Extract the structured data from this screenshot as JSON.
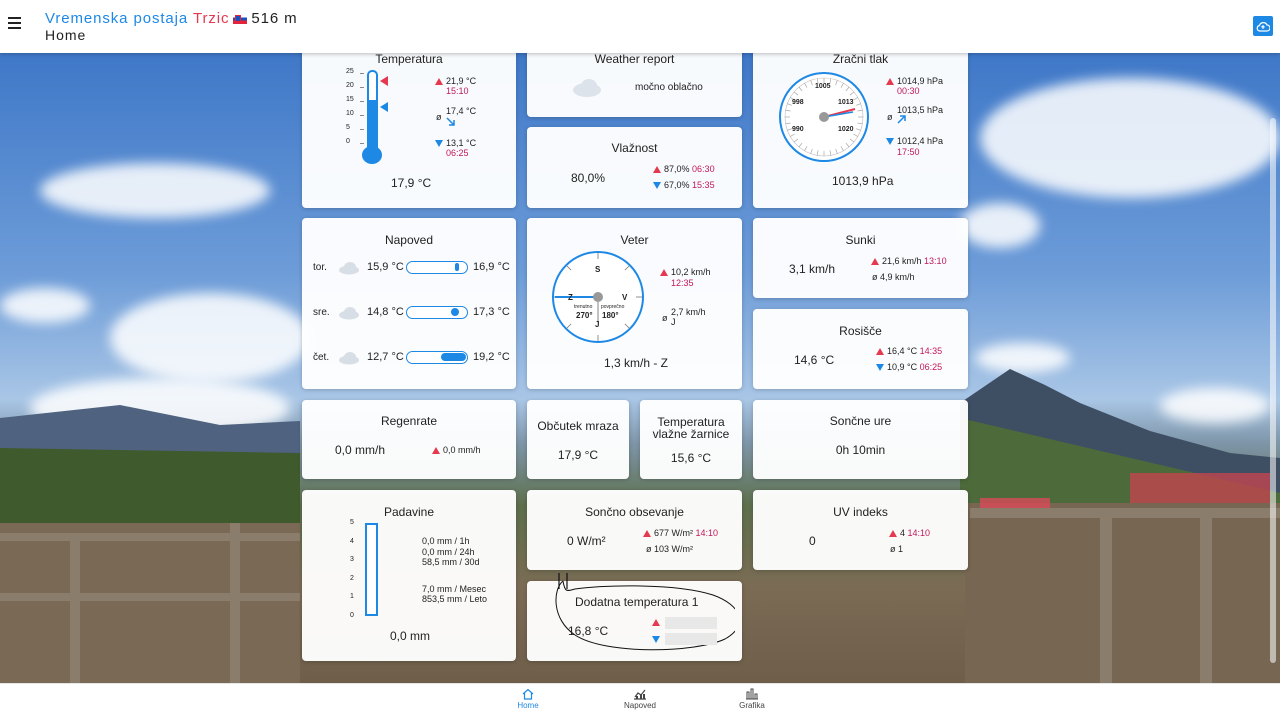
{
  "header": {
    "title_part1": "Vremenska postaja",
    "title_part2": "Trzic",
    "title_part3": "516 m",
    "subtitle": "Home"
  },
  "icons": {
    "menu": "menu-icon",
    "sync": "cloud-upload-icon",
    "flag": "slovenia-flag-icon"
  },
  "colors": {
    "accent": "#1e88e5",
    "high": "#e53950",
    "time": "#c2185b",
    "low": "#1e88e5"
  },
  "temperatura": {
    "title": "Temperatura",
    "scale": [
      "25",
      "20",
      "15",
      "10",
      "5",
      "0"
    ],
    "max": "21,9 °C",
    "max_time": "15:10",
    "avg_symbol": "ø",
    "avg": "17,4 °C",
    "min": "13,1 °C",
    "min_time": "06:25",
    "current": "17,9 °C",
    "current_value": 17.9,
    "scale_max": 25
  },
  "weather_report": {
    "title": "Weather report",
    "text": "močno oblačno"
  },
  "zracni_tlak": {
    "title": "Zračni tlak",
    "gauge_labels": [
      "1005",
      "998",
      "1013",
      "990",
      "1020"
    ],
    "max": "1014,9 hPa",
    "max_time": "00:30",
    "avg_symbol": "ø",
    "avg": "1013,5 hPa",
    "min": "1012,4 hPa",
    "min_time": "17:50",
    "current": "1013,9 hPa"
  },
  "vlaznost": {
    "title": "Vlažnost",
    "current": "80,0%",
    "max": "87,0%",
    "max_time": "06:30",
    "min": "67,0%",
    "min_time": "15:35"
  },
  "napoved": {
    "title": "Napoved",
    "days": [
      {
        "day": "tor.",
        "min": "15,9 °C",
        "max": "16,9 °C"
      },
      {
        "day": "sre.",
        "min": "14,8 °C",
        "max": "17,3 °C"
      },
      {
        "day": "čet.",
        "min": "12,7 °C",
        "max": "19,2 °C"
      }
    ]
  },
  "veter": {
    "title": "Veter",
    "compass": {
      "n": "S",
      "w": "Z",
      "e": "V",
      "s": "J"
    },
    "label_current": "trenutno",
    "label_avg": "povprečno",
    "dir_current": "270°",
    "dir_avg": "180°",
    "max": "10,2 km/h",
    "max_time": "12:35",
    "avg_symbol": "ø",
    "avg": "2,7 km/h",
    "avg_dir": "J",
    "current": "1,3 km/h - Z"
  },
  "sunki": {
    "title": "Sunki",
    "current": "3,1 km/h",
    "max": "21,6 km/h",
    "max_time": "13:10",
    "avg_symbol": "ø",
    "avg": "4,9 km/h"
  },
  "rosisce": {
    "title": "Rosišče",
    "current": "14,6 °C",
    "max": "16,4 °C",
    "max_time": "14:35",
    "min": "10,9 °C",
    "min_time": "06:25"
  },
  "regenrate": {
    "title": "Regenrate",
    "current": "0,0 mm/h",
    "max": "0,0 mm/h"
  },
  "obcutek": {
    "title": "Občutek mraza",
    "value": "17,9 °C"
  },
  "vlazna": {
    "title_line1": "Temperatura",
    "title_line2": "vlažne žarnice",
    "value": "15,6 °C"
  },
  "soncne_ure": {
    "title": "Sončne ure",
    "value": "0h 10min"
  },
  "padavine": {
    "title": "Padavine",
    "scale": [
      "5",
      "4",
      "3",
      "2",
      "1",
      "0"
    ],
    "rows": [
      "0,0 mm / 1h",
      "0,0 mm / 24h",
      "58,5 mm / 30d",
      "7,0 mm  / Mesec",
      "853,5 mm / Leto"
    ],
    "current": "0,0 mm"
  },
  "soncno": {
    "title": "Sončno obsevanje",
    "current": "0 W/m²",
    "max": "677 W/m²",
    "max_time": "14:10",
    "avg_symbol": "ø",
    "avg": "103 W/m²"
  },
  "uv": {
    "title": "UV indeks",
    "current": "0",
    "max": "4",
    "max_time": "14:10",
    "avg_symbol": "ø",
    "avg": "1"
  },
  "dodatna": {
    "title": "Dodatna temperatura 1",
    "value": "16,8 °C"
  },
  "nav": [
    {
      "label": "Home",
      "icon": "home-icon"
    },
    {
      "label": "Napoved",
      "icon": "chart-icon"
    },
    {
      "label": "Grafika",
      "icon": "bar-chart-icon"
    }
  ]
}
